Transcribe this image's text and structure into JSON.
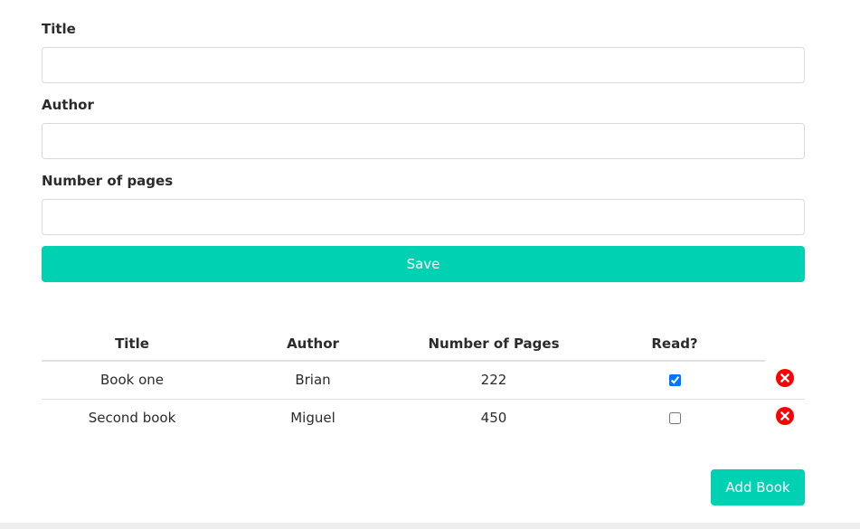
{
  "form": {
    "title_label": "Title",
    "title_value": "",
    "author_label": "Author",
    "author_value": "",
    "pages_label": "Number of pages",
    "pages_value": "",
    "save_label": "Save"
  },
  "table": {
    "headers": [
      "Title",
      "Author",
      "Number of Pages",
      "Read?"
    ],
    "rows": [
      {
        "title": "Book one",
        "author": "Brian",
        "pages": "222",
        "read": true
      },
      {
        "title": "Second book",
        "author": "Miguel",
        "pages": "450",
        "read": false
      }
    ]
  },
  "add_book_label": "Add Book",
  "colors": {
    "accent": "#00d1b2",
    "delete": "#ff0000"
  },
  "icons": {
    "delete": "close-circle-icon"
  }
}
